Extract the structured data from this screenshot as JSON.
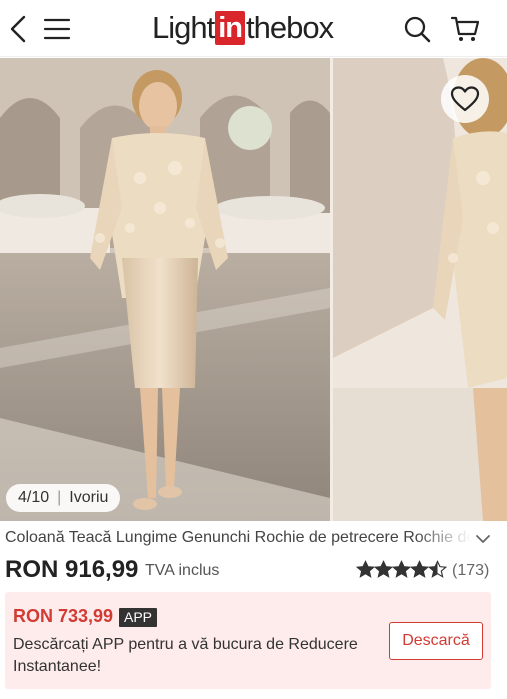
{
  "header": {
    "logo": {
      "left": "Light",
      "mid": "in",
      "right": "thebox"
    },
    "icons": [
      "back-arrow-icon",
      "hamburger-menu-icon",
      "search-icon",
      "cart-icon"
    ]
  },
  "gallery": {
    "counter": "4/10",
    "color_name": "Ivoriu",
    "favorite_icon": "heart-icon"
  },
  "product": {
    "title": "Coloană Teacă Lungime Genunchi Rochie de petrecere Rochie de",
    "price": "RON 916,99",
    "tax_label": "TVA inclus",
    "rating": 4.5,
    "review_count": "(173)"
  },
  "promo": {
    "price": "RON 733,99",
    "tag": "APP",
    "text": "Descărcați APP pentru a vă bucura de Reducere Instantanee!",
    "button": "Descarcă"
  },
  "colors": {
    "accent_red": "#d23b34",
    "logo_red": "#d8262b",
    "promo_bg": "#fdeceb",
    "star": "#333333"
  }
}
